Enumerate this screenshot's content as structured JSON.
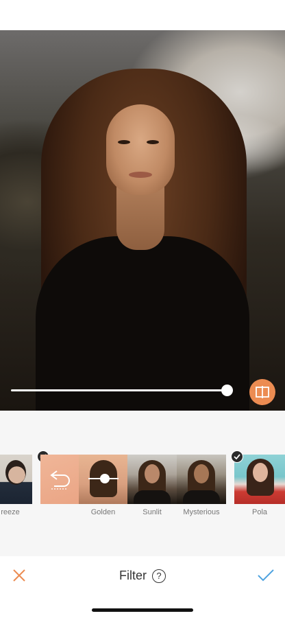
{
  "screen": {
    "title": "Filter",
    "help_icon": "help-circle-icon"
  },
  "intensity": {
    "value": 1.0
  },
  "compare_button": {
    "icon": "compare-icon",
    "color": "#EC8C52"
  },
  "filters": [
    {
      "label": "reeze",
      "selected": true
    },
    {
      "label": "Golden",
      "selected": false
    },
    {
      "label": "Sunlit",
      "selected": false
    },
    {
      "label": "Mysterious",
      "selected": false
    },
    {
      "label": "Pola",
      "selected": true
    }
  ],
  "toolbar": {
    "cancel_icon": "close-icon",
    "confirm_icon": "checkmark-icon",
    "cancel_color": "#EC8C52",
    "confirm_color": "#4FA3E0"
  }
}
